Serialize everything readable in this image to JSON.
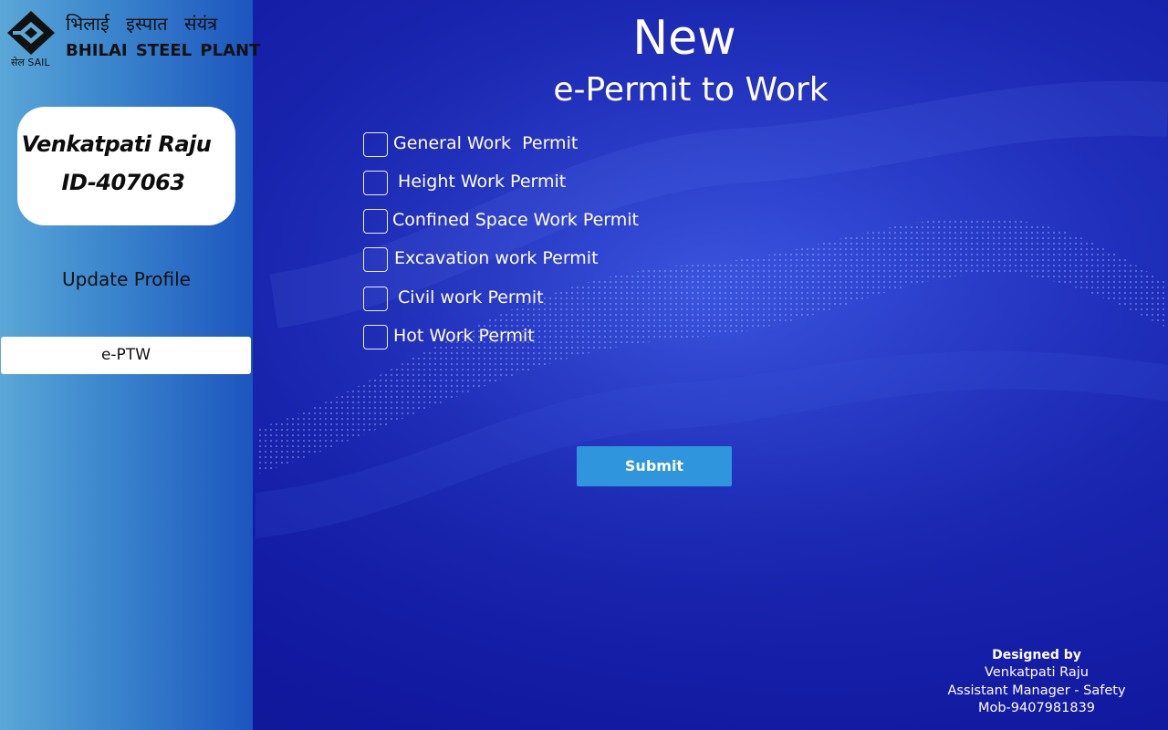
{
  "brand": {
    "hindi_name": "भिलाई इस्पात संयंत्र",
    "english_name": "BHILAI STEEL PLANT",
    "sail_mark": "सेल SAIL"
  },
  "profile": {
    "name": "Venkatpati Raju",
    "id": "ID-407063"
  },
  "sidebar": {
    "update_profile_label": "Update Profile",
    "eptw_label": "e-PTW"
  },
  "header": {
    "title_line1": "New",
    "title_line2": "e-Permit to Work"
  },
  "permits": [
    {
      "label": "General Work  Permit",
      "checked": false
    },
    {
      "label": " Height Work Permit",
      "checked": false
    },
    {
      "label": "Confined Space Work Permit",
      "checked": false
    },
    {
      "label": "Excavation work Permit",
      "checked": false
    },
    {
      "label": " Civil work Permit",
      "checked": false
    },
    {
      "label": "Hot Work Permit",
      "checked": false
    }
  ],
  "submit_label": "Submit",
  "credits": {
    "heading": "Designed by",
    "name": "Venkatpati Raju",
    "role": "Assistant Manager - Safety",
    "mobile": "Mob-9407981839"
  },
  "colors": {
    "background": "#1a26b0",
    "sidebar_start": "#5aa7d8",
    "sidebar_end": "#1c55bf",
    "submit": "#2f95dd"
  }
}
